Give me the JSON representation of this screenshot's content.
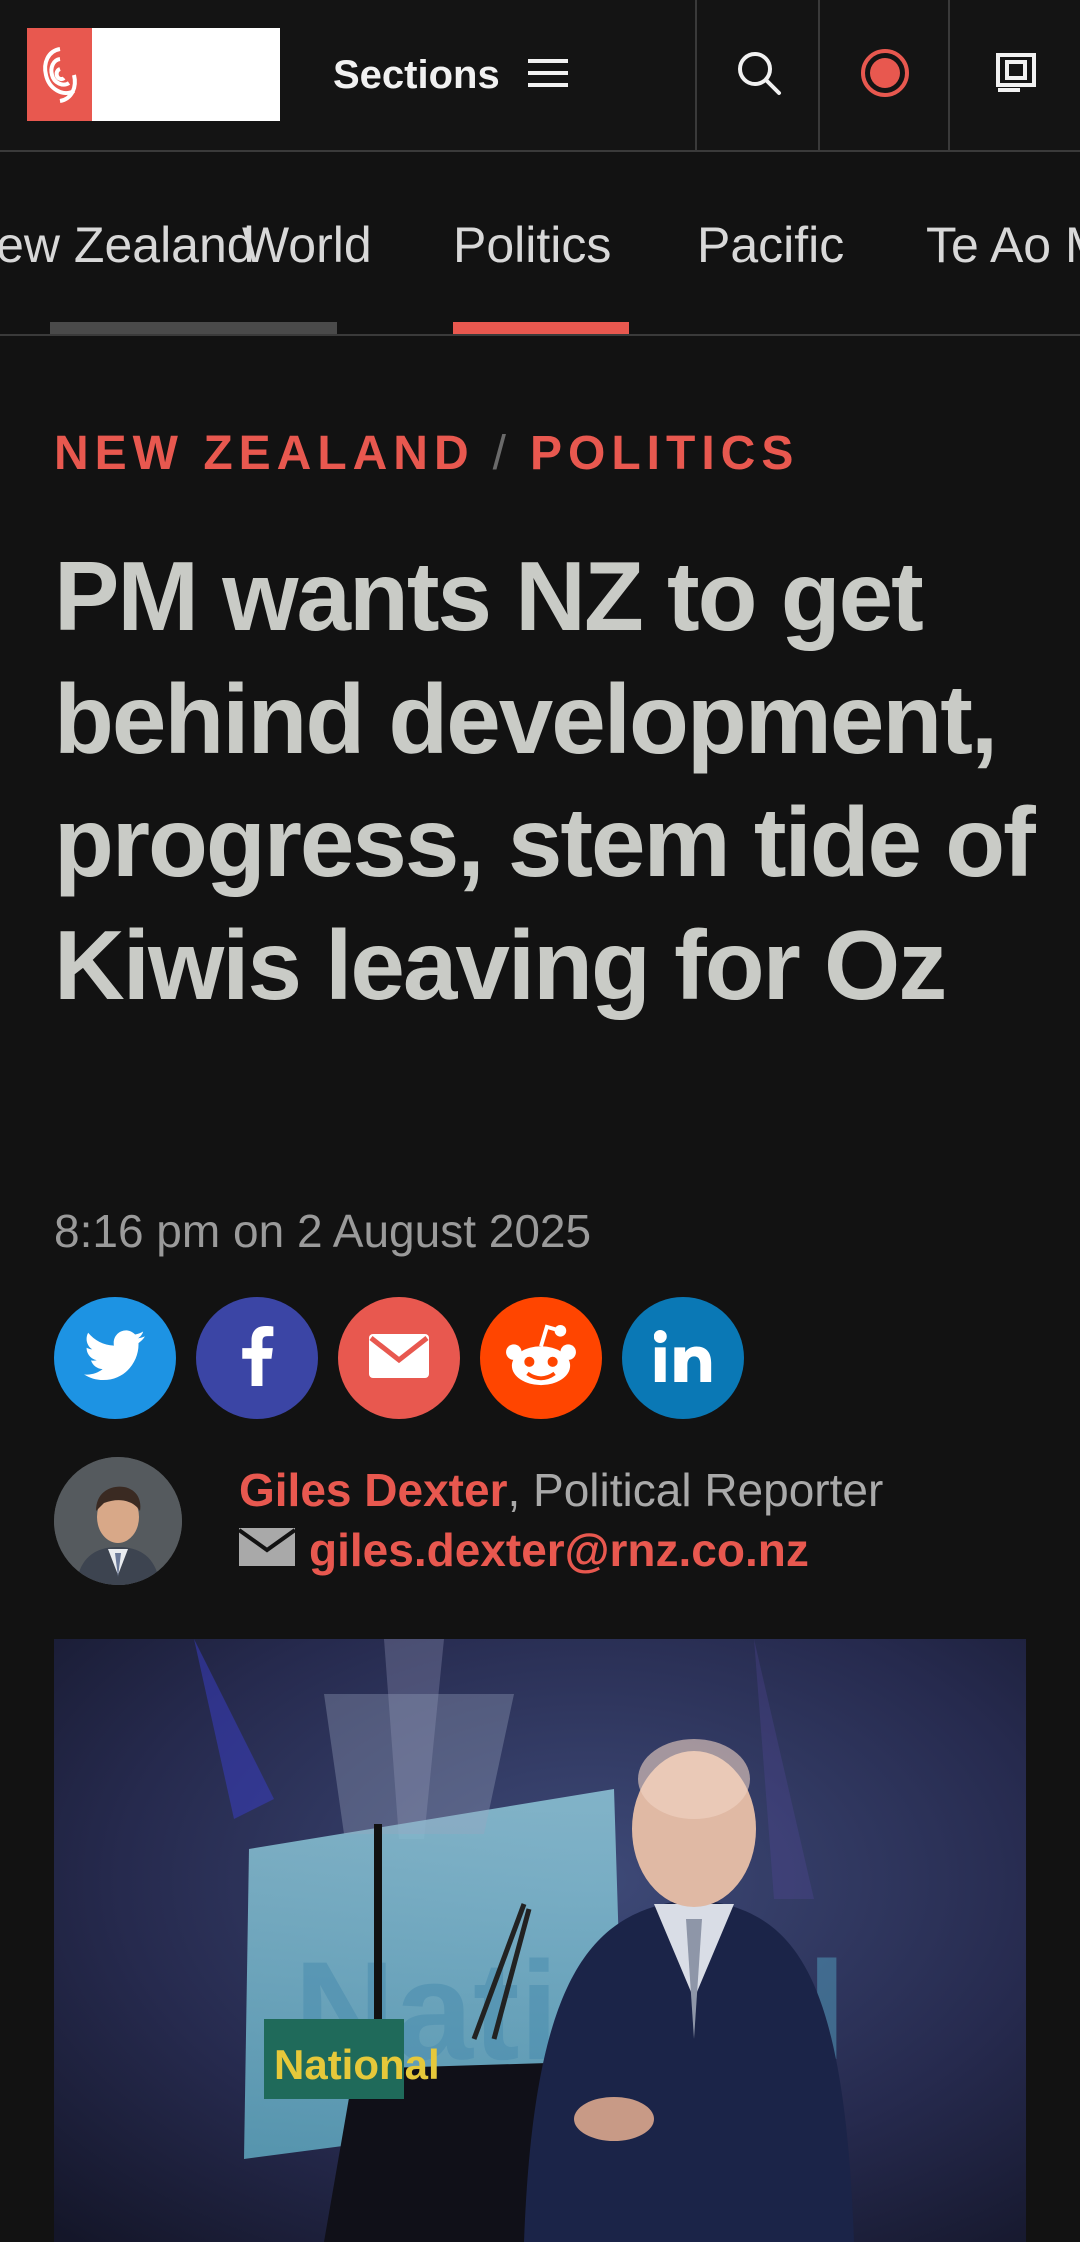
{
  "header": {
    "sections_label": "Sections"
  },
  "nav": {
    "tabs": [
      {
        "label": "New Zealand"
      },
      {
        "label": "World"
      },
      {
        "label": "Politics"
      },
      {
        "label": "Pacific"
      },
      {
        "label": "Te Ao Māori"
      }
    ],
    "active_tab": "Politics"
  },
  "article": {
    "kicker": {
      "primary": "NEW ZEALAND",
      "separator": "/",
      "secondary": "POLITICS"
    },
    "headline": "PM wants NZ to get behind development, progress, stem tide of Kiwis leaving for Oz",
    "timestamp": "8:16 pm on 2 August 2025",
    "share_buttons": [
      {
        "icon": "twitter-icon",
        "color": "#1d93e3"
      },
      {
        "icon": "facebook-icon",
        "color": "#3b45a5"
      },
      {
        "icon": "email-icon",
        "color": "#e8584f"
      },
      {
        "icon": "reddit-icon",
        "color": "#ff4500"
      },
      {
        "icon": "linkedin-icon",
        "color": "#0a78b5"
      }
    ],
    "author": {
      "name": "Giles Dexter",
      "role": ", Political Reporter",
      "email": "giles.dexter@rnz.co.nz"
    },
    "hero_image": {
      "sign_text": "National",
      "backdrop_text": "National"
    }
  },
  "colors": {
    "accent": "#e8584f",
    "background": "#121212",
    "headline": "#c9cbc6",
    "tab_inactive_underline": "#4a4a4a"
  }
}
